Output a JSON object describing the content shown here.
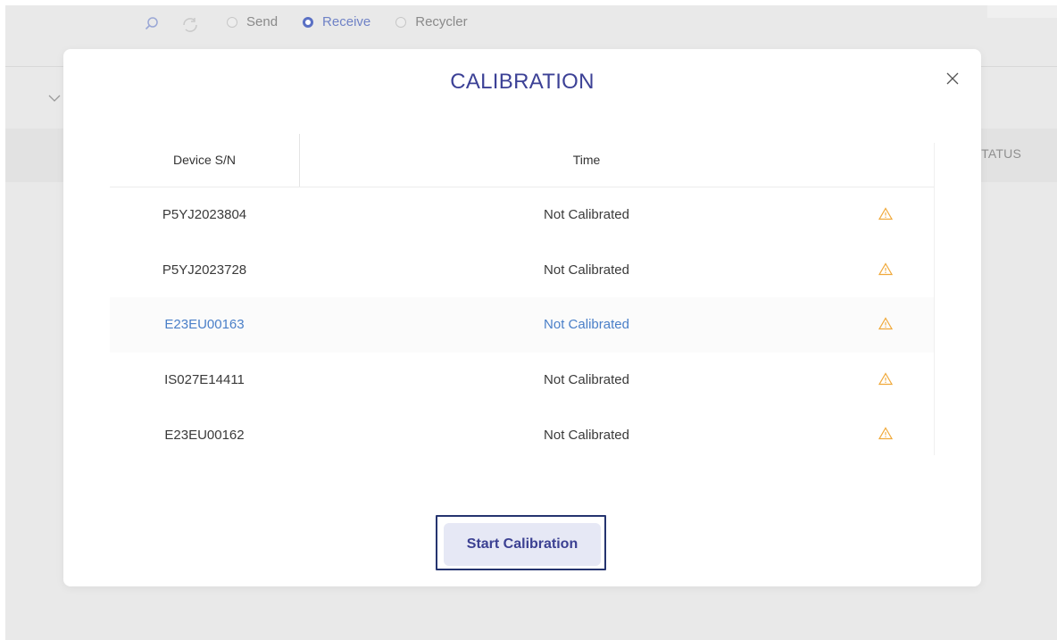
{
  "background": {
    "toolbar": {
      "icons": [
        "search-icon",
        "refresh-icon"
      ],
      "radios": [
        {
          "label": "Send",
          "checked": false
        },
        {
          "label": "Receive",
          "checked": true
        },
        {
          "label": "Recycler",
          "checked": false
        }
      ]
    },
    "table_header_partial": "STATUS"
  },
  "modal": {
    "title": "CALIBRATION",
    "close_icon": "close-icon",
    "columns": {
      "serial": "Device S/N",
      "time": "Time"
    },
    "rows": [
      {
        "serial": "P5YJ2023804",
        "time": "Not Calibrated",
        "status_icon": "warning-icon",
        "highlighted": false
      },
      {
        "serial": "P5YJ2023728",
        "time": "Not Calibrated",
        "status_icon": "warning-icon",
        "highlighted": false
      },
      {
        "serial": "E23EU00163",
        "time": "Not Calibrated",
        "status_icon": "warning-icon",
        "highlighted": true
      },
      {
        "serial": "IS027E14411",
        "time": "Not Calibrated",
        "status_icon": "warning-icon",
        "highlighted": false
      },
      {
        "serial": "E23EU00162",
        "time": "Not Calibrated",
        "status_icon": "warning-icon",
        "highlighted": false
      }
    ],
    "start_button": "Start Calibration"
  },
  "colors": {
    "title": "#3c4196",
    "accent": "#5a70c4",
    "warning": "#f0a93a",
    "highlight_text": "#4a7fc8"
  }
}
